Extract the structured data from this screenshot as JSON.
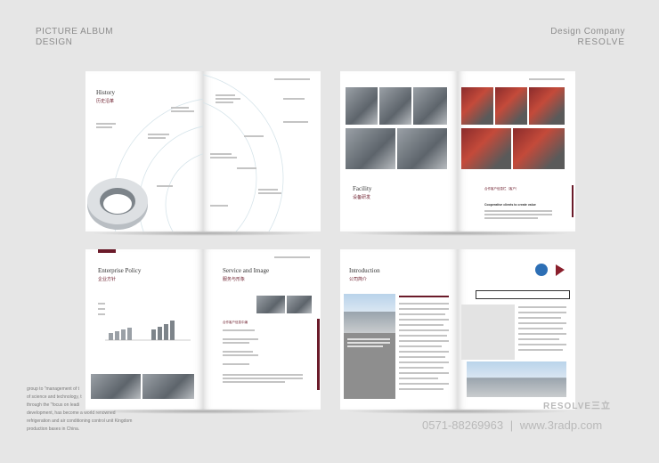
{
  "header_left": {
    "line1": "PICTURE ALBUM",
    "line2": "DESIGN"
  },
  "header_right": {
    "line1": "Design Company",
    "line2": "RESOLVE"
  },
  "spreads": {
    "history": {
      "title": "History",
      "subtitle": "历史沿革"
    },
    "facility": {
      "title": "Facility",
      "subtitle": "设备研发",
      "right_heading": "合作客户信息栏（客户）",
      "right_sub": "Cooperative clients to create value"
    },
    "policy": {
      "title": "Enterprise Policy",
      "subtitle": "企业方针"
    },
    "service": {
      "title": "Service and Image",
      "subtitle": "服务与形象",
      "sub_heading": "合作客户信息中编"
    },
    "intro": {
      "title": "Introduction",
      "subtitle": "公司简介"
    }
  },
  "overlay_text": [
    "group to \"management of t",
    "of science and technology, t",
    "through the \"focus on leadi",
    "development, has become a world renowned",
    "refrigeration and air conditioning control unit Kingdom",
    "production bases in China."
  ],
  "footer": {
    "brand": "RESOLVE三立",
    "phone": "0571-88269963",
    "separator": "|",
    "website": "www.3radp.com"
  },
  "colors": {
    "accent": "#6b1b2a",
    "background": "#e6e6e6"
  }
}
